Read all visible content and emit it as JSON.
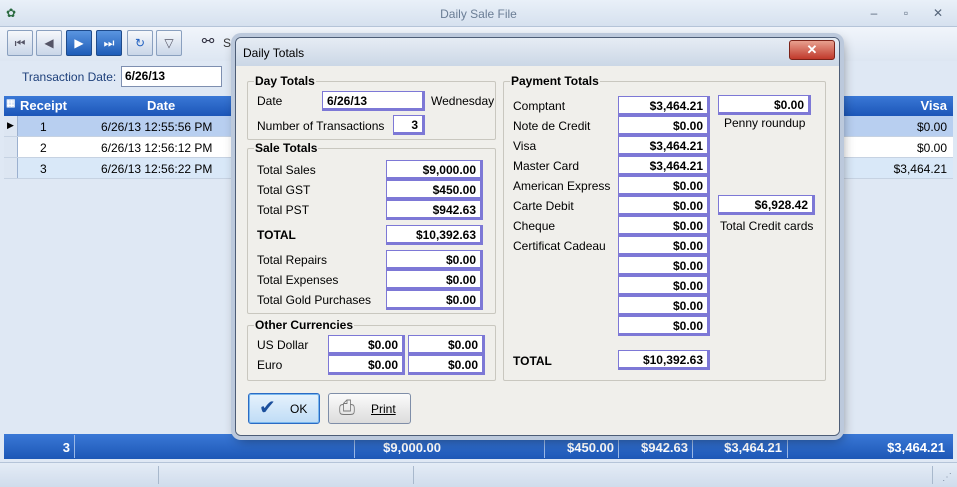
{
  "window": {
    "title": "Daily Sale File",
    "controls": [
      "–",
      "▫",
      "✕"
    ]
  },
  "toolbar": {
    "search_label": "Se"
  },
  "transaction": {
    "label": "Transaction Date:",
    "value": "6/26/13"
  },
  "grid": {
    "headers": {
      "receipt": "Receipt",
      "date": "Date",
      "visa": "Visa"
    },
    "rows": [
      {
        "receipt": "1",
        "date": "6/26/13 12:55:56 PM",
        "visa": "$0.00"
      },
      {
        "receipt": "2",
        "date": "6/26/13 12:56:12 PM",
        "visa": "$0.00"
      },
      {
        "receipt": "3",
        "date": "6/26/13 12:56:22 PM",
        "visa": "$3,464.21"
      }
    ]
  },
  "grid_totals": {
    "count": "3",
    "sales": "$9,000.00",
    "gst": "$450.00",
    "pst": "$942.63",
    "mastercard": "$3,464.21",
    "visa": "$3,464.21"
  },
  "dialog": {
    "title": "Daily Totals",
    "close_glyph": "✕",
    "day_totals": {
      "heading": "Day Totals",
      "date_label": "Date",
      "date_value": "6/26/13",
      "weekday": "Wednesday",
      "num_tx_label": "Number of Transactions",
      "num_tx_value": "3"
    },
    "sale_totals": {
      "heading": "Sale Totals",
      "total_sales_label": "Total Sales",
      "total_sales": "$9,000.00",
      "total_gst_label": "Total GST",
      "total_gst": "$450.00",
      "total_pst_label": "Total PST",
      "total_pst": "$942.63",
      "total_label": "TOTAL",
      "total": "$10,392.63",
      "repairs_label": "Total Repairs",
      "repairs": "$0.00",
      "expenses_label": "Total Expenses",
      "expenses": "$0.00",
      "gold_label": "Total Gold Purchases",
      "gold": "$0.00"
    },
    "other_currencies": {
      "heading": "Other Currencies",
      "usd_label": "US Dollar",
      "usd_1": "$0.00",
      "usd_2": "$0.00",
      "euro_label": "Euro",
      "euro_1": "$0.00",
      "euro_2": "$0.00"
    },
    "payment_totals": {
      "heading": "Payment Totals",
      "items": [
        {
          "label": "Comptant",
          "value": "$3,464.21"
        },
        {
          "label": "Note de Credit",
          "value": "$0.00"
        },
        {
          "label": "Visa",
          "value": "$3,464.21"
        },
        {
          "label": "Master Card",
          "value": "$3,464.21"
        },
        {
          "label": "American Express",
          "value": "$0.00"
        },
        {
          "label": "Carte Debit",
          "value": "$0.00"
        },
        {
          "label": "Cheque",
          "value": "$0.00"
        },
        {
          "label": "Certificat Cadeau",
          "value": "$0.00"
        },
        {
          "label": "",
          "value": "$0.00"
        },
        {
          "label": "",
          "value": "$0.00"
        },
        {
          "label": "",
          "value": "$0.00"
        },
        {
          "label": "",
          "value": "$0.00"
        }
      ],
      "penny_roundup_value": "$0.00",
      "penny_roundup_label": "Penny roundup",
      "credit_cards_value": "$6,928.42",
      "credit_cards_label": "Total Credit cards",
      "total_label": "TOTAL",
      "total": "$10,392.63"
    },
    "buttons": {
      "ok": "OK",
      "print": "Print"
    }
  }
}
